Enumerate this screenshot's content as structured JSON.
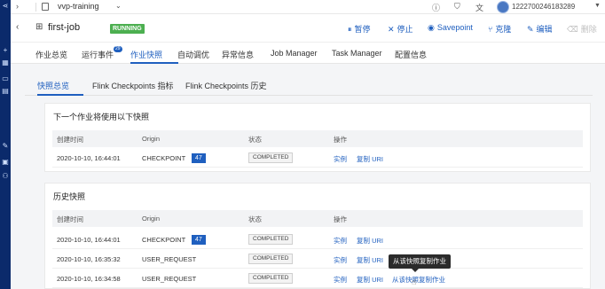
{
  "topbar": {
    "workspace": "vvp-training",
    "user": "1222700246183289",
    "icons": [
      "help-icon",
      "shirt-icon",
      "translate-icon"
    ]
  },
  "job": {
    "name": "first-job",
    "state": "RUNNING",
    "actions": [
      {
        "icon": "pause-icon",
        "glyph": "⏸",
        "label": "暂停"
      },
      {
        "icon": "stop-icon",
        "glyph": "✕",
        "label": "停止"
      },
      {
        "icon": "camera-icon",
        "glyph": "◉",
        "label": "Savepoint"
      },
      {
        "icon": "clone-icon",
        "glyph": "⑂",
        "label": "克隆"
      },
      {
        "icon": "edit-icon",
        "glyph": "✎",
        "label": "编辑"
      },
      {
        "icon": "delete-icon",
        "glyph": "🗑",
        "label": "删除"
      }
    ]
  },
  "tabs": [
    {
      "label": "作业总览"
    },
    {
      "label": "运行事件",
      "count": "29"
    },
    {
      "label": "作业快照"
    },
    {
      "label": "自动调优"
    },
    {
      "label": "异常信息"
    },
    {
      "label": "Job Manager"
    },
    {
      "label": "Task Manager"
    },
    {
      "label": "配置信息"
    }
  ],
  "subtabs": [
    {
      "label": "快照总览"
    },
    {
      "label": "Flink Checkpoints 指标"
    },
    {
      "label": "Flink Checkpoints 历史"
    }
  ],
  "next_card": {
    "title": "下一个作业将使用以下快照",
    "headers": [
      "创建时间",
      "Origin",
      "状态",
      "操作"
    ],
    "rows": [
      {
        "time": "2020-10-10, 16:44:01",
        "origin": "CHECKPOINT",
        "num": "47",
        "status": "COMPLETED",
        "op1": "实例",
        "op2": "复制 URI"
      }
    ]
  },
  "history_card": {
    "title": "历史快照",
    "headers": [
      "创建时间",
      "Origin",
      "状态",
      "操作"
    ],
    "rows": [
      {
        "time": "2020-10-10, 16:44:01",
        "origin": "CHECKPOINT",
        "num": "47",
        "status": "COMPLETED",
        "op1": "实例",
        "op2": "复制 URI",
        "op3": ""
      },
      {
        "time": "2020-10-10, 16:35:32",
        "origin": "USER_REQUEST",
        "num": "",
        "status": "COMPLETED",
        "op1": "实例",
        "op2": "复制 URI",
        "op3": ""
      },
      {
        "time": "2020-10-10, 16:34:58",
        "origin": "USER_REQUEST",
        "num": "",
        "status": "COMPLETED",
        "op1": "实例",
        "op2": "复制 URI",
        "op3": "从该快照复制作业"
      }
    ]
  },
  "tooltip": "从该快照复制作业"
}
